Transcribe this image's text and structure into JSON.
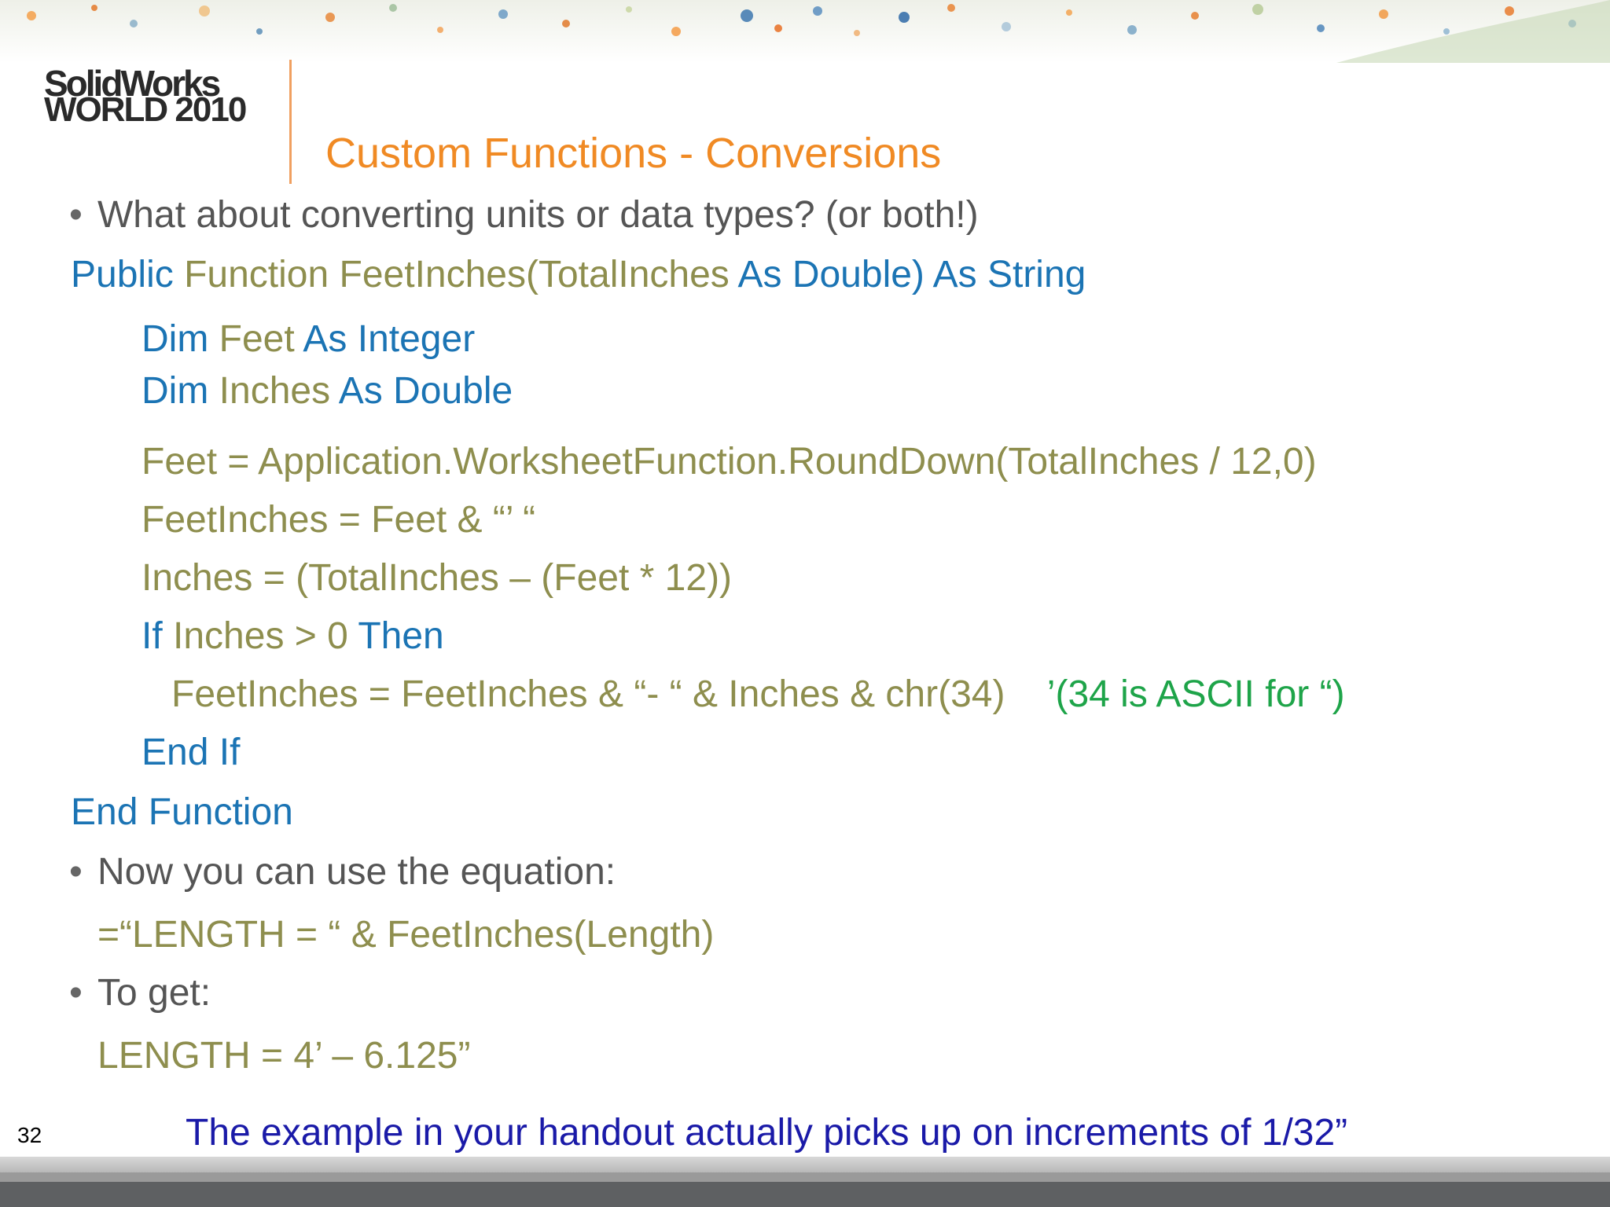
{
  "logo": {
    "line1": "SolidWorks",
    "line2": "WORLD 2010"
  },
  "slide": {
    "title": "Custom Functions - Conversions",
    "page_number": "32"
  },
  "bullets": {
    "b1": "What about converting units or data types? (or both!)",
    "b2": "Now you can use the equation:",
    "b3": "To get:"
  },
  "code": {
    "l1": {
      "kw1": "Public",
      "t1": "Function FeetInches(TotalInches",
      "kw2": "As Double)",
      "kw3": "As String"
    },
    "l2": {
      "kw1": "Dim",
      "t1": "Feet",
      "kw2": "As Integer"
    },
    "l3": {
      "kw1": "Dim",
      "t1": "Inches",
      "kw2": "As Double"
    },
    "l4": "Feet = Application.WorksheetFunction.RoundDown(TotalInches / 12,0)",
    "l5": "FeetInches = Feet & “’ “",
    "l6": "Inches = (TotalInches – (Feet * 12))",
    "l7": {
      "kw1": "If",
      "t1": "Inches > 0",
      "kw2": "Then"
    },
    "l8": {
      "t1": "FeetInches = FeetInches & “- “ & Inches & chr(34)",
      "comment": "’(34 is ASCII for “)"
    },
    "l9": "End If",
    "l10": "End Function"
  },
  "equation": "=“LENGTH = “ & FeetInches(Length)",
  "result": "LENGTH = 4’ – 6.125”",
  "note": "The example in your handout actually picks up on increments of 1/32”",
  "colors": {
    "title": "#f08a24",
    "keyword": "#1b74b4",
    "code_text": "#8e8e4e",
    "comment": "#1ea449",
    "note": "#1a1aa8",
    "bullet_text": "#555555"
  }
}
